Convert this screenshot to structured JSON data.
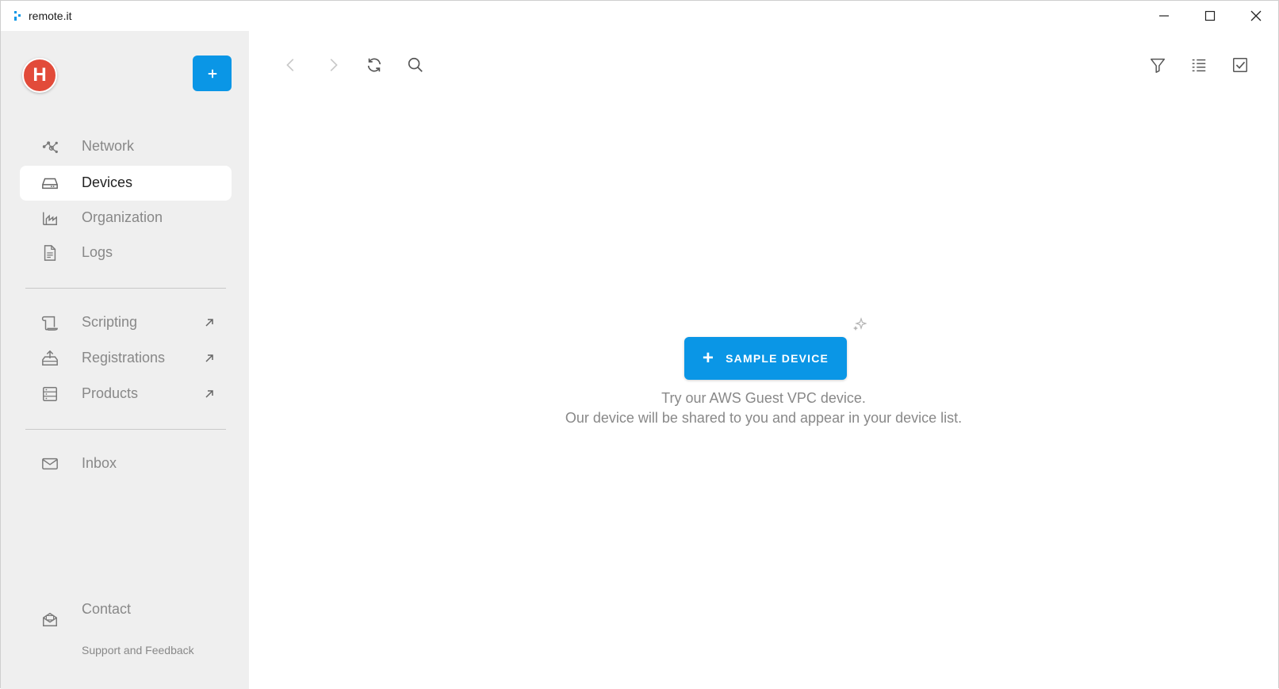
{
  "window": {
    "title": "remote.it",
    "controls": [
      "minimize-icon",
      "maximize-icon",
      "close-icon"
    ]
  },
  "sidebar": {
    "avatar_initial": "H",
    "nav": [
      {
        "label": "Network",
        "icon": "network-icon"
      },
      {
        "label": "Devices",
        "icon": "devices-icon",
        "active": true
      },
      {
        "label": "Organization",
        "icon": "organization-icon"
      },
      {
        "label": "Logs",
        "icon": "logs-icon"
      }
    ],
    "links": [
      {
        "label": "Scripting",
        "icon": "scripting-icon"
      },
      {
        "label": "Registrations",
        "icon": "registrations-icon"
      },
      {
        "label": "Products",
        "icon": "products-icon"
      }
    ],
    "inbox": {
      "label": "Inbox",
      "icon": "inbox-icon"
    },
    "contact": {
      "label": "Contact",
      "sublabel": "Support and Feedback",
      "icon": "contact-icon"
    }
  },
  "toolbar": {
    "left": [
      "back-icon",
      "forward-icon",
      "refresh-icon",
      "search-icon"
    ],
    "right": [
      "filter-icon",
      "columns-icon",
      "select-icon"
    ]
  },
  "empty_state": {
    "button_label": "SAMPLE DEVICE",
    "line1": "Try our AWS Guest VPC device.",
    "line2": "Our device will be shared to you and appear in your device list."
  },
  "colors": {
    "accent": "#0a96e6",
    "avatar": "#e24b3a",
    "sidebar_bg": "#efefef",
    "muted_text": "#888888"
  }
}
